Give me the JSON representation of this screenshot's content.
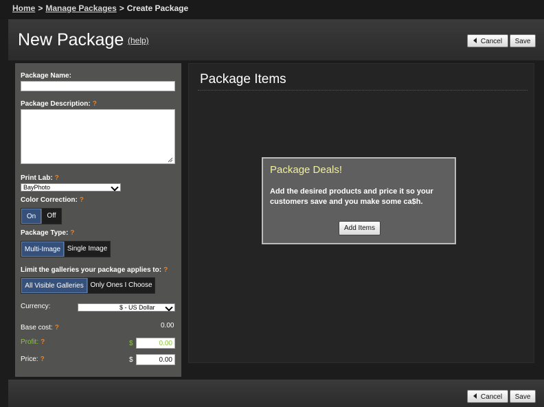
{
  "breadcrumb": {
    "home": "Home",
    "manage_packages": "Manage Packages",
    "current": "Create Package",
    "separator": ">"
  },
  "header": {
    "title": "New Package",
    "help": "(help)",
    "cancel": "Cancel",
    "save": "Save"
  },
  "form": {
    "package_name_label": "Package Name:",
    "package_name_value": "",
    "description_label": "Package Description:",
    "description_value": "",
    "print_lab_label": "Print Lab:",
    "print_lab_value": "BayPhoto",
    "color_correction_label": "Color Correction:",
    "color_correction_options": [
      "On",
      "Off"
    ],
    "color_correction_selected": "On",
    "package_type_label": "Package Type:",
    "package_type_options": [
      "Multi-Image",
      "Single Image"
    ],
    "package_type_selected": "Multi-Image",
    "galleries_label": "Limit the galleries your package applies to:",
    "galleries_options": [
      "All Visible Galleries",
      "Only Ones I Choose"
    ],
    "galleries_selected": "All Visible Galleries",
    "currency_label": "Currency:",
    "currency_value": "$ - US Dollar",
    "base_cost_label": "Base cost:",
    "base_cost_value": "0.00",
    "profit_label": "Profit:",
    "profit_currency": "$",
    "profit_value": "0.00",
    "price_label": "Price:",
    "price_currency": "$",
    "price_value": "0.00",
    "help_marker": "?"
  },
  "items": {
    "title": "Package Items",
    "deal_title": "Package Deals!",
    "deal_text": "Add the desired products and price it so your customers save and you make some ca$h.",
    "add_items": "Add Items"
  },
  "footer": {
    "cancel": "Cancel",
    "save": "Save"
  },
  "colors": {
    "accent_selected": "#35507a",
    "help_marker": "#f07f1d",
    "profit_green": "#8dc63f",
    "deal_title": "#f2f09a"
  }
}
